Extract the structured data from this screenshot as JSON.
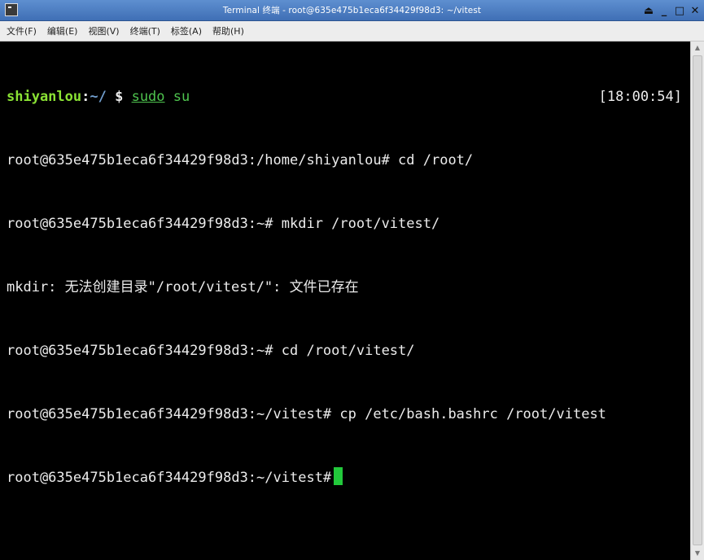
{
  "window": {
    "title": "Terminal 终端 - root@635e475b1eca6f34429f98d3: ~/vitest",
    "controls": {
      "eject": "⏏",
      "minimize": "_",
      "maximize": "□",
      "close": "✕"
    }
  },
  "menubar": {
    "items": [
      {
        "label": "文件(F)"
      },
      {
        "label": "编辑(E)"
      },
      {
        "label": "视图(V)"
      },
      {
        "label": "终端(T)"
      },
      {
        "label": "标签(A)"
      },
      {
        "label": "帮助(H)"
      }
    ]
  },
  "terminal": {
    "prompt": {
      "user": "shiyanlou",
      "sep": ":",
      "dir": "~/",
      "dollar": " $ ",
      "cmd_sudo": "sudo",
      "cmd_su": " su",
      "clock": "[18:00:54]"
    },
    "lines": [
      "root@635e475b1eca6f34429f98d3:/home/shiyanlou# cd /root/",
      "root@635e475b1eca6f34429f98d3:~# mkdir /root/vitest/",
      "mkdir: 无法创建目录\"/root/vitest/\": 文件已存在",
      "root@635e475b1eca6f34429f98d3:~# cd /root/vitest/",
      "root@635e475b1eca6f34429f98d3:~/vitest# cp /etc/bash.bashrc /root/vitest",
      "root@635e475b1eca6f34429f98d3:~/vitest#"
    ],
    "colors": {
      "background": "#000000",
      "text": "#ececec",
      "user": "#8ae234",
      "dir": "#729fcf",
      "cursor": "#22c93b"
    }
  },
  "icons": {
    "app": "terminal-icon",
    "scroll_up": "scroll-up-arrow-icon",
    "scroll_down": "scroll-down-arrow-icon"
  }
}
